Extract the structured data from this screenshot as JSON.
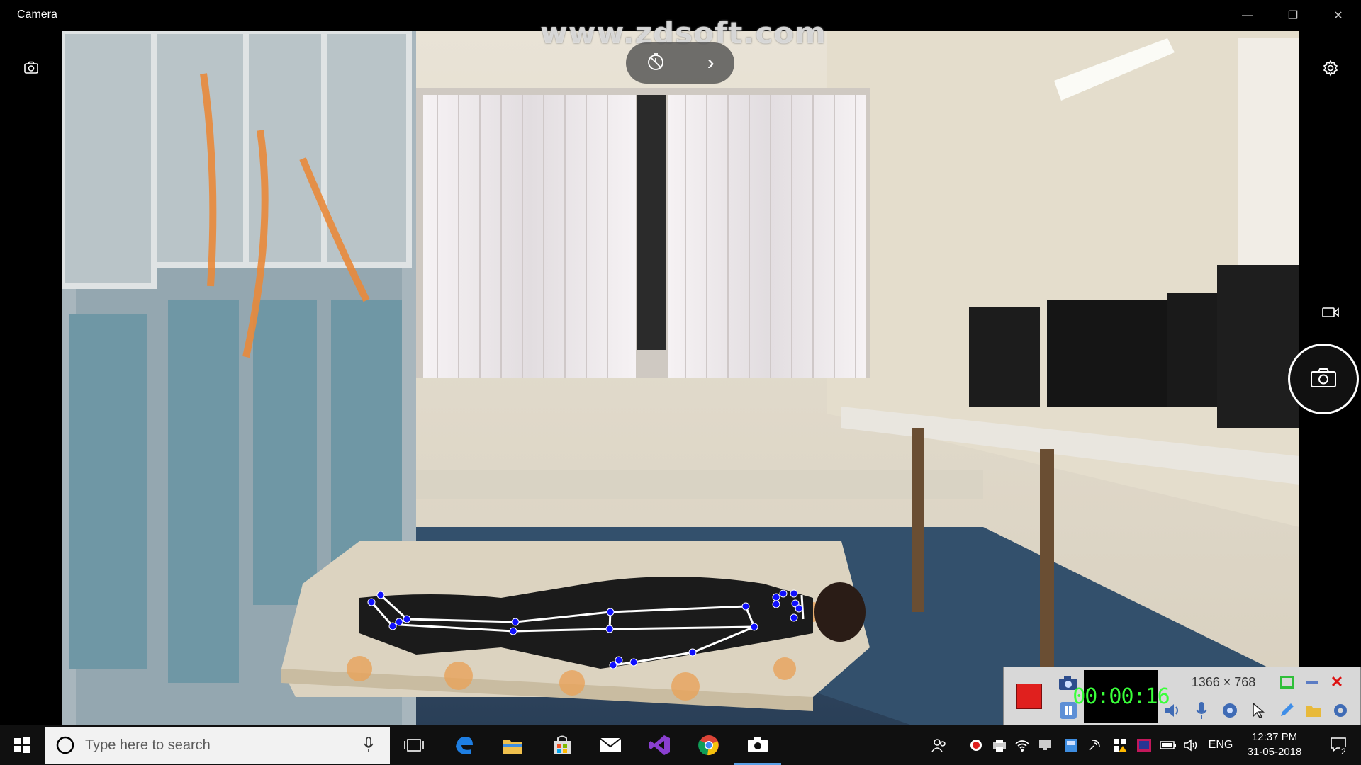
{
  "window": {
    "title": "Camera",
    "minimize_glyph": "—",
    "restore_glyph": "❐",
    "close_glyph": "✕"
  },
  "watermark": "www.zdsoft.com",
  "camera": {
    "left_icon": "camera-switch-icon",
    "timer_icon": "self-timer-icon",
    "timer_expand_glyph": "›",
    "settings_icon": "gear-icon",
    "video_mode_icon": "video-camera-icon",
    "shutter_icon": "photo-camera-icon"
  },
  "recorder": {
    "time": "00:00:16",
    "resolution": "1366 × 768",
    "colors": {
      "record": "#e0201e",
      "timer": "#39ff39"
    }
  },
  "taskbar": {
    "search_placeholder": "Type here to search",
    "apps": [
      "task-view-icon",
      "edge-icon",
      "file-explorer-icon",
      "store-icon",
      "mail-icon",
      "visual-studio-icon",
      "chrome-icon",
      "camera-app-icon"
    ],
    "tray_language": "ENG",
    "clock_time": "12:37 PM",
    "clock_date": "31-05-2018",
    "notification_count": "2"
  }
}
